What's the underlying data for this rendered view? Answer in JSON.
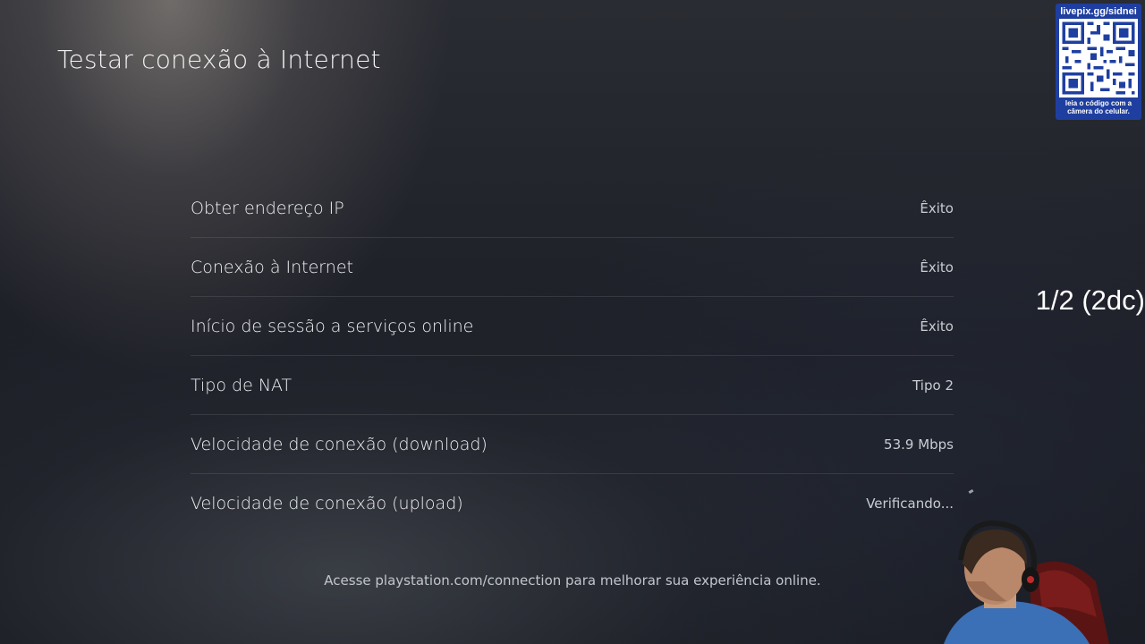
{
  "page": {
    "title": "Testar conexão à Internet"
  },
  "results": [
    {
      "label": "Obter endereço IP",
      "value": "Êxito"
    },
    {
      "label": "Conexão à Internet",
      "value": "Êxito"
    },
    {
      "label": "Início de sessão a serviços online",
      "value": "Êxito"
    },
    {
      "label": "Tipo de NAT",
      "value": "Tipo 2"
    },
    {
      "label": "Velocidade de conexão (download)",
      "value": "53.9 Mbps"
    },
    {
      "label": "Velocidade de conexão (upload)",
      "value": "Verificando..."
    }
  ],
  "footer": {
    "note": "Acesse playstation.com/connection para melhorar sua experiência online."
  },
  "stream_overlay": {
    "qr_url": "livepix.gg/sidnei",
    "qr_caption_line1": "leia o código com a",
    "qr_caption_line2": "câmera do celular.",
    "counter": "1/2 (2dc)",
    "accent_color": "#1f3fa0"
  }
}
